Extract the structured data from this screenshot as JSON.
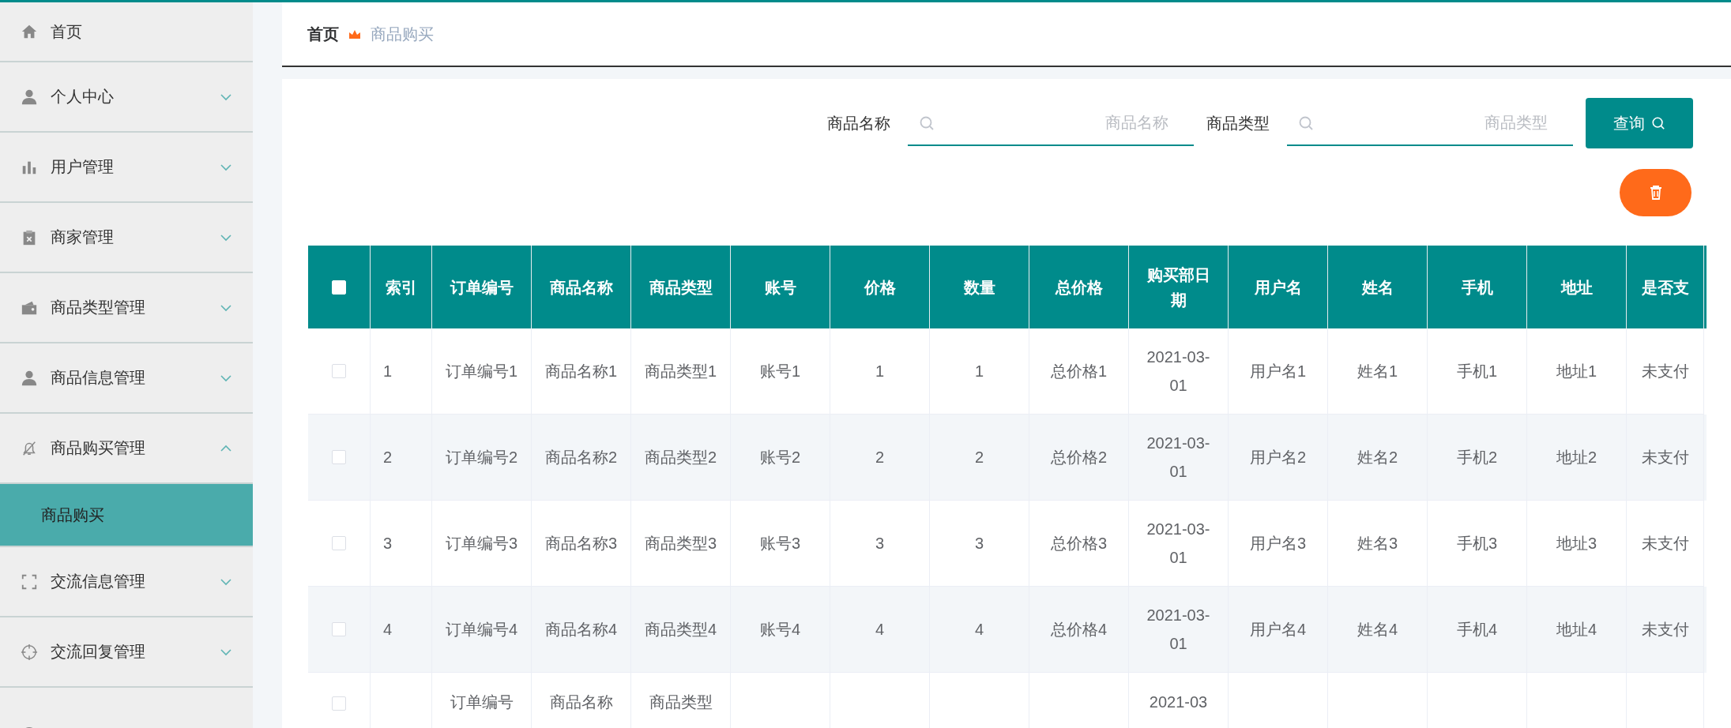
{
  "sidebar": {
    "items": [
      {
        "label": "首页",
        "kind": "link"
      },
      {
        "label": "个人中心",
        "kind": "group",
        "expanded": false
      },
      {
        "label": "用户管理",
        "kind": "group",
        "expanded": false
      },
      {
        "label": "商家管理",
        "kind": "group",
        "expanded": false
      },
      {
        "label": "商品类型管理",
        "kind": "group",
        "expanded": false
      },
      {
        "label": "商品信息管理",
        "kind": "group",
        "expanded": false
      },
      {
        "label": "商品购买管理",
        "kind": "group",
        "expanded": true,
        "children": [
          {
            "label": "商品购买",
            "selected": true
          }
        ]
      },
      {
        "label": "交流信息管理",
        "kind": "group",
        "expanded": false
      },
      {
        "label": "交流回复管理",
        "kind": "group",
        "expanded": false
      }
    ]
  },
  "breadcrumb": [
    "首页",
    "商品购买"
  ],
  "search": {
    "fields": [
      {
        "label": "商品名称",
        "placeholder": "商品名称"
      },
      {
        "label": "商品类型",
        "placeholder": "商品类型"
      }
    ],
    "button": "查询"
  },
  "table": {
    "all_checked": false,
    "columns": [
      "索引",
      "订单编号",
      "商品名称",
      "商品类型",
      "账号",
      "价格",
      "数量",
      "总价格",
      "购买部日期",
      "用户名",
      "姓名",
      "手机",
      "地址",
      "是否支"
    ],
    "rows": [
      {
        "checked": false,
        "cut": false,
        "cells": [
          "1",
          "订单编号1",
          "商品名称1",
          "商品类型1",
          "账号1",
          "1",
          "1",
          "总价格1",
          "2021-03-01",
          "用户名1",
          "姓名1",
          "手机1",
          "地址1",
          "未支付"
        ]
      },
      {
        "checked": false,
        "cut": false,
        "cells": [
          "2",
          "订单编号2",
          "商品名称2",
          "商品类型2",
          "账号2",
          "2",
          "2",
          "总价格2",
          "2021-03-01",
          "用户名2",
          "姓名2",
          "手机2",
          "地址2",
          "未支付"
        ]
      },
      {
        "checked": false,
        "cut": false,
        "cells": [
          "3",
          "订单编号3",
          "商品名称3",
          "商品类型3",
          "账号3",
          "3",
          "3",
          "总价格3",
          "2021-03-01",
          "用户名3",
          "姓名3",
          "手机3",
          "地址3",
          "未支付"
        ]
      },
      {
        "checked": false,
        "cut": false,
        "cells": [
          "4",
          "订单编号4",
          "商品名称4",
          "商品类型4",
          "账号4",
          "4",
          "4",
          "总价格4",
          "2021-03-01",
          "用户名4",
          "姓名4",
          "手机4",
          "地址4",
          "未支付"
        ]
      },
      {
        "checked": false,
        "cut": true,
        "cells": [
          null,
          "订单编号",
          "商品名称",
          "商品类型",
          null,
          null,
          null,
          null,
          "2021-03",
          null,
          null,
          null,
          null,
          null
        ]
      }
    ]
  }
}
